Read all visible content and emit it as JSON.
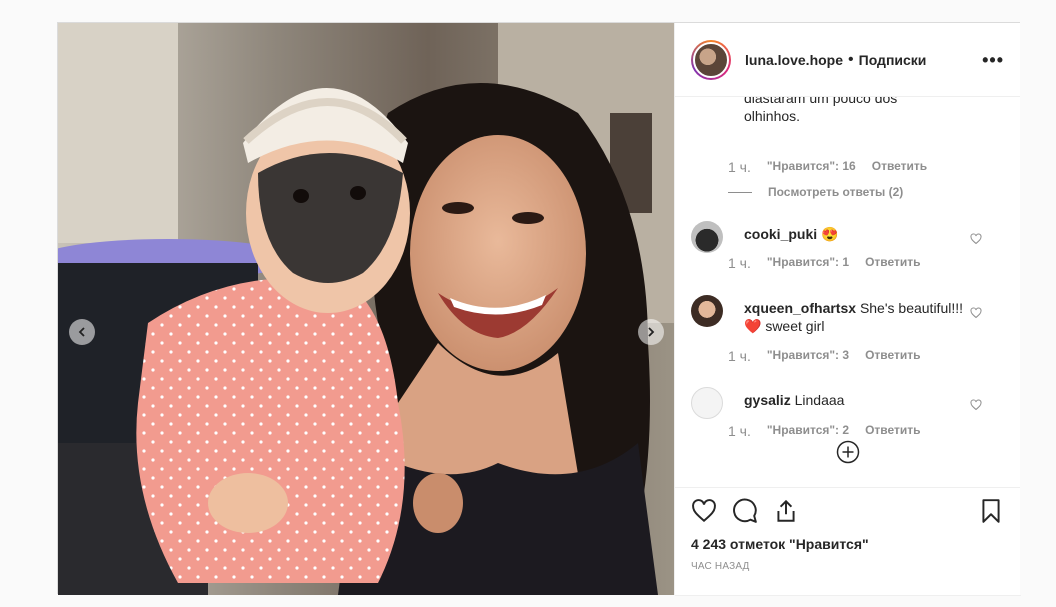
{
  "header": {
    "username": "luna.love.hope",
    "separator": "•",
    "follow_label": "Подписки",
    "more_label": "•••"
  },
  "comments": {
    "partial_text": "diastaram um pouco dos olhinhos.",
    "partial_meta": {
      "time": "1 ч.",
      "likes": "\"Нравится\": 16",
      "reply": "Ответить"
    },
    "view_replies": "Посмотреть ответы (2)",
    "items": [
      {
        "username": "cooki_puki",
        "text": "😍",
        "time": "1 ч.",
        "likes": "\"Нравится\": 1",
        "reply": "Ответить"
      },
      {
        "username": "xqueen_ofhartsx",
        "text": "She's beautiful!!! ❤️ sweet girl",
        "time": "1 ч.",
        "likes": "\"Нравится\": 3",
        "reply": "Ответить"
      },
      {
        "username": "gysaliz",
        "text": "Lindaaa",
        "time": "1 ч.",
        "likes": "\"Нравится\": 2",
        "reply": "Ответить"
      }
    ]
  },
  "actions": {
    "likes_count": "4 243 отметок \"Нравится\"",
    "time_ago": "час назад"
  },
  "icons": {
    "like": "heart-icon",
    "comment": "comment-icon",
    "share": "share-icon",
    "save": "bookmark-icon",
    "load_more": "plus-circle-icon",
    "prev": "chevron-left-icon",
    "next": "chevron-right-icon"
  },
  "colors": {
    "heart_red": "#ed4956",
    "muted": "#8e8e8e",
    "border": "#dbdbdb"
  }
}
